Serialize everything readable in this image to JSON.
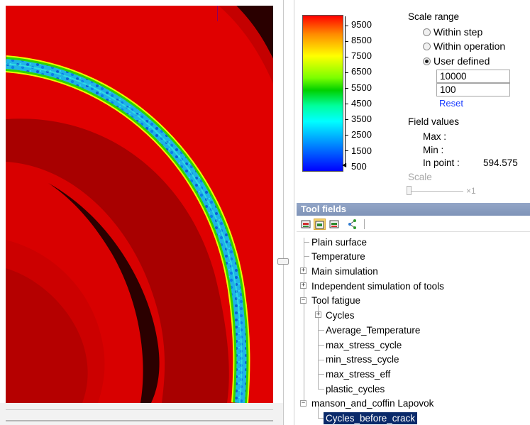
{
  "legend": {
    "labels": [
      "9500",
      "8500",
      "7500",
      "6500",
      "5500",
      "4500",
      "3500",
      "2500",
      "1500",
      "500"
    ]
  },
  "scale_range": {
    "title": "Scale range",
    "options": [
      {
        "label": "Within step",
        "checked": false
      },
      {
        "label": "Within operation",
        "checked": false
      },
      {
        "label": "User defined",
        "checked": true
      }
    ],
    "max_value": "10000",
    "min_value": "100",
    "reset_label": "Reset"
  },
  "field_values": {
    "title": "Field values",
    "max_label": "Max :",
    "min_label": "Min :",
    "in_point_label": "In point :",
    "in_point_value": "594.575"
  },
  "scale": {
    "label": "Scale",
    "multiplier": "×1"
  },
  "tool_fields": {
    "header": "Tool fields",
    "toolbar_icons": [
      "layer-icon",
      "layer-active-icon",
      "layer-alt-icon",
      "share-icon"
    ],
    "tree": [
      {
        "label": "Plain surface"
      },
      {
        "label": "Temperature"
      },
      {
        "label": "Main simulation"
      },
      {
        "label": "Independent simulation of tools"
      },
      {
        "label": "Tool fatigue"
      },
      {
        "label": "Cycles"
      },
      {
        "label": "Average_Temperature"
      },
      {
        "label": "max_stress_cycle"
      },
      {
        "label": "min_stress_cycle"
      },
      {
        "label": "max_stress_eff"
      },
      {
        "label": "plastic_cycles"
      },
      {
        "label": "manson_and_coffin Lapovok"
      },
      {
        "label": "Cycles_before_crack"
      }
    ]
  },
  "colors": {
    "field_red": "#e00000",
    "selection": "#0a2a6a",
    "link": "#1a3cff",
    "header": "#8799bd"
  }
}
